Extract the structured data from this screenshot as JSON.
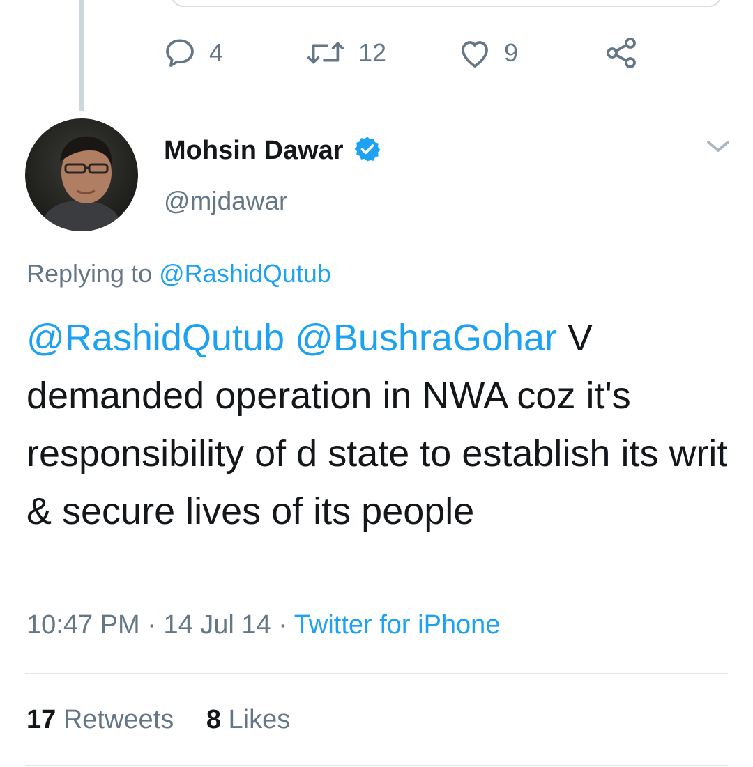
{
  "previous_tweet": {
    "actions": {
      "reply_count": "4",
      "retweet_count": "12",
      "like_count": "9"
    }
  },
  "tweet": {
    "author": {
      "display_name": "Mohsin Dawar",
      "handle": "@mjdawar",
      "verified": true
    },
    "replying_to": {
      "label": "Replying to",
      "mention": "@RashidQutub"
    },
    "body": {
      "mention_1": "@RashidQutub",
      "mention_2": "@BushraGohar",
      "text": "V demanded operation in NWA coz it's responsibility of d state to establish its writ & secure lives of its people"
    },
    "meta": {
      "time": "10:47 PM",
      "separator": "·",
      "date": "14 Jul 14",
      "source": "Twitter for iPhone"
    },
    "stats": {
      "retweets_count": "17",
      "retweets_label": "Retweets",
      "likes_count": "8",
      "likes_label": "Likes"
    }
  },
  "icons": {
    "reply": "reply-icon",
    "retweet": "retweet-icon",
    "like": "heart-icon",
    "share": "share-icon",
    "verified": "verified-badge-icon",
    "caret": "chevron-down-icon"
  },
  "colors": {
    "link": "#1da1f2",
    "text": "#14171a",
    "secondary": "#657786",
    "divider": "#e1e8ed"
  }
}
